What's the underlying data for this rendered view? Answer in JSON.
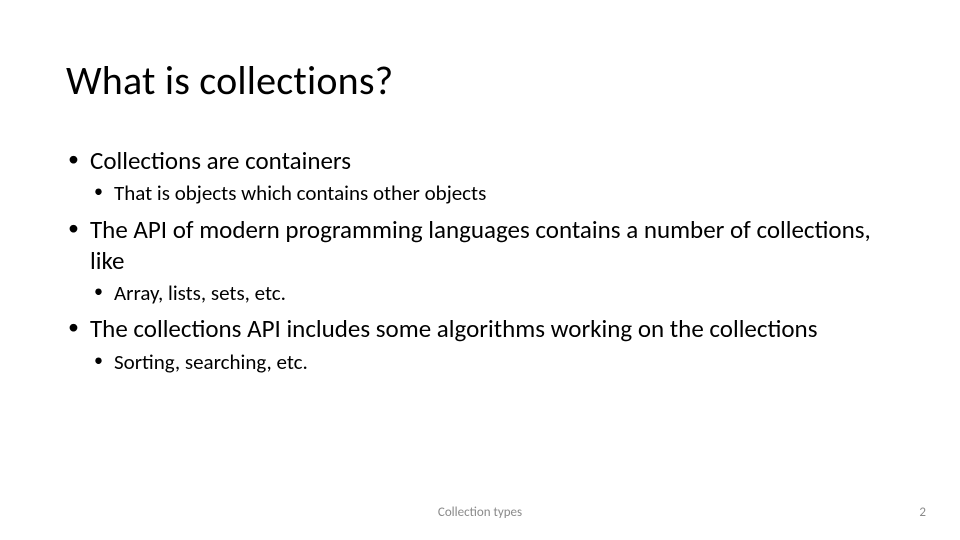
{
  "title": "What is collections?",
  "bullets": {
    "b1": "Collections are containers",
    "b1_1": "That is objects which contains other objects",
    "b2": "The API of modern programming languages contains a number of collections, like",
    "b2_1": "Array, lists, sets, etc.",
    "b3": "The collections API includes some algorithms working on the collections",
    "b3_1": "Sorting, searching, etc."
  },
  "footer": {
    "center": "Collection types",
    "page": "2"
  }
}
